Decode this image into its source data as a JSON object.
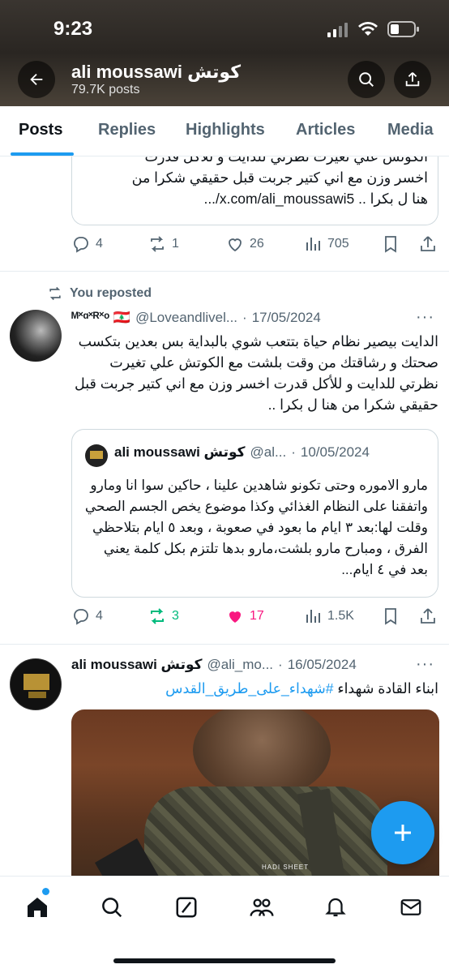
{
  "status": {
    "time": "9:23"
  },
  "profile": {
    "name": "ali moussawi كوتش",
    "posts": "79.7K posts"
  },
  "tabs": [
    {
      "label": "Posts"
    },
    {
      "label": "Replies"
    },
    {
      "label": "Highlights"
    },
    {
      "label": "Articles"
    },
    {
      "label": "Media"
    }
  ],
  "post1": {
    "quote_text_lines": [
      "الكوتش علي تغيرت نظرتي للدايت و للأكل قدرت",
      "اخسر وزن مع اني كتير جربت قبل حقيقي شكرا من",
      "هنا ل بكرا .. x.com/ali_moussawi5/..."
    ],
    "replies": "4",
    "reposts": "1",
    "likes": "26",
    "views": "705"
  },
  "post2": {
    "repost_label": "You reposted",
    "author_name": "ᴹ˟ᵅ˟ᴿ˟ᵒ 🇱🇧",
    "handle": "@Loveandlivel...",
    "dot": "·",
    "date": "17/05/2024",
    "text": "الدايت بيصير نظام حياة بتتعب شوي بالبداية بس بعدين بتكسب صحتك و رشاقتك من وقت بلشت مع الكوتش علي تغيرت نظرتي للدايت و للأكل قدرت اخسر وزن مع اني كتير جربت قبل حقيقي شكرا من هنا ل بكرا ..",
    "quote": {
      "author_name": "ali moussawi كوتش",
      "handle": "@al...",
      "dot": "·",
      "date": "10/05/2024",
      "text": "مارو الاموره وحتى تكونو شاهدين علينا ، حاكين سوا انا ومارو واتفقنا على النظام الغذائي وكذا موضوع يخص الجسم الصحي وقلت لها:بعد ٣ ايام ما بعود في صعوبة ، وبعد ٥ ايام بتلاحظي الفرق ، ومبارح مارو بلشت،مارو بدها تلتزم بكل كلمة يعني بعد في ٤ ايام..."
    },
    "replies": "4",
    "reposts": "3",
    "likes": "17",
    "views": "1.5K"
  },
  "post3": {
    "author_name": "ali moussawi كوتش",
    "handle": "@ali_mo...",
    "dot": "·",
    "date": "16/05/2024",
    "text_plain": "ابناء القادة شهداء ",
    "hashtag": "#شهداء_على_طريق_القدس",
    "media_patch": "HADI SHEET"
  },
  "colors": {
    "accent": "#1d9bf0",
    "repost_active": "#00ba7c",
    "like_active": "#f91880"
  },
  "icons": [
    "back-arrow-icon",
    "search-icon",
    "share-icon",
    "reply-icon",
    "repost-icon",
    "like-icon",
    "views-icon",
    "bookmark-icon",
    "home-icon",
    "explore-icon",
    "grok-icon",
    "communities-icon",
    "notifications-icon",
    "messages-icon",
    "compose-icon"
  ]
}
